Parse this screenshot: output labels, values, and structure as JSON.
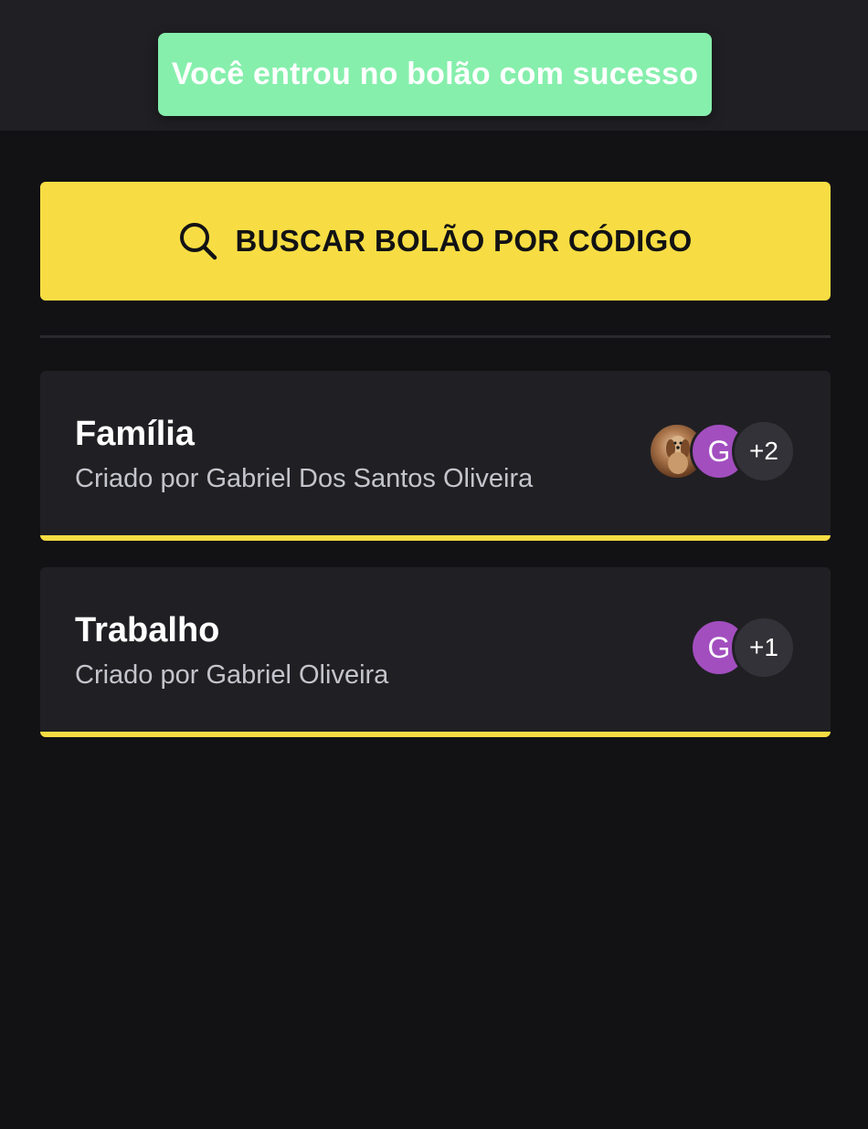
{
  "toast": {
    "message": "Você entrou no bolão com sucesso",
    "color": "#86efac"
  },
  "search_button": {
    "label": "BUSCAR BOLÃO POR CÓDIGO",
    "icon": "search-icon",
    "color": "#f7dd43"
  },
  "pools": [
    {
      "title": "Família",
      "subtitle": "Criado por Gabriel Dos Santos Oliveira",
      "avatar_photo": "user-photo",
      "avatar_letter": "G",
      "extra_count": "+2"
    },
    {
      "title": "Trabalho",
      "subtitle": "Criado por Gabriel Oliveira",
      "avatar_letter": "G",
      "extra_count": "+1"
    }
  ],
  "colors": {
    "background": "#121214",
    "card": "#202024",
    "accent": "#f7dd43",
    "avatar_letter_bg": "#a24ebf"
  }
}
